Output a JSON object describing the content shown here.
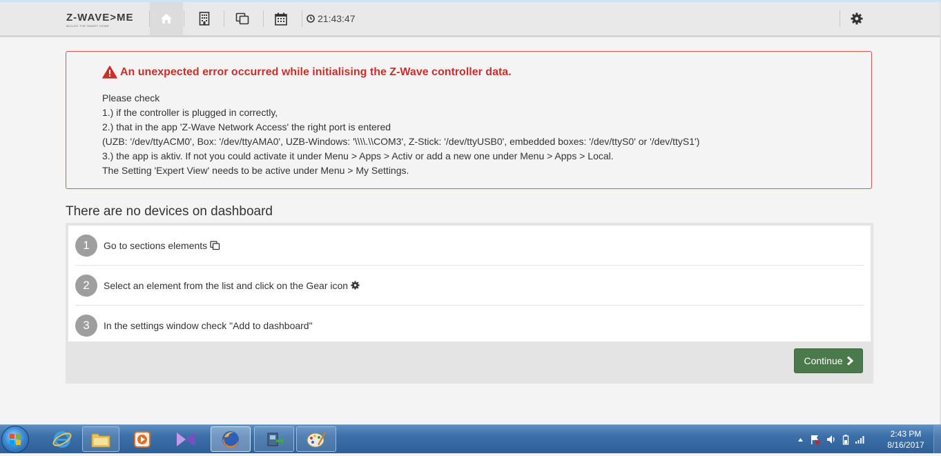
{
  "header": {
    "logo_text": "Z-WAVE>ME",
    "logo_tagline": "BUILDS THE SMART HOME",
    "nav_icons": [
      "home-icon",
      "building-icon",
      "elements-icon",
      "calendar-icon"
    ],
    "time": "21:43:47",
    "settings_icon": "gear-icon"
  },
  "alert": {
    "title": "An unexpected error occurred while initialising the Z-Wave controller data.",
    "lines": [
      "Please check",
      "1.) if the controller is plugged in correctly,",
      "2.) that in the app 'Z-Wave Network Access' the right port is entered",
      "(UZB: '/dev/ttyACM0', Box: '/dev/ttyAMA0', UZB-Windows: '\\\\\\\\.\\\\COM3', Z-Stick: '/dev/ttyUSB0', embedded boxes: '/dev/ttyS0' or '/dev/ttyS1')",
      "3.) the app is aktiv. If not you could activate it under Menu > Apps > Activ or add a new one under Menu > Apps > Local.",
      "The Setting 'Expert View' needs to be active under Menu > My Settings."
    ],
    "color": "#c9302c"
  },
  "dashboard": {
    "title": "There are no devices on dashboard",
    "steps": [
      {
        "num": "1",
        "text": "Go to sections elements"
      },
      {
        "num": "2",
        "text": "Select an element from the list and click on the Gear icon"
      },
      {
        "num": "3",
        "text": "In the settings window check \"Add to dashboard\""
      }
    ],
    "continue_label": "Continue",
    "continue_color": "#4a7a4c"
  },
  "taskbar": {
    "apps": [
      "internet-explorer-icon",
      "file-explorer-icon",
      "media-player-icon",
      "visual-studio-icon",
      "firefox-icon",
      "network-tool-icon",
      "paint-icon"
    ],
    "clock_time": "2:43 PM",
    "clock_date": "8/16/2017"
  }
}
